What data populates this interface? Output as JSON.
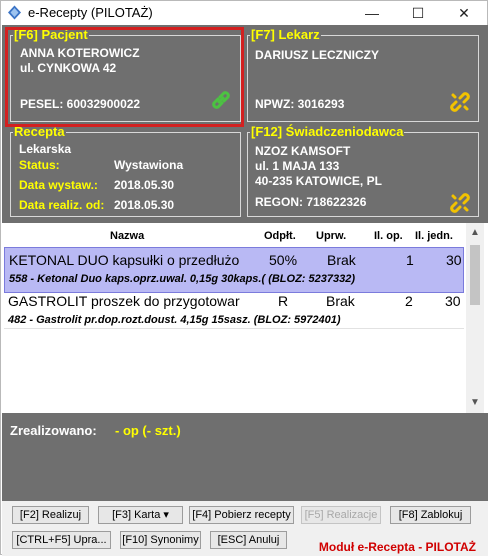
{
  "window": {
    "title": "e-Recepty (PILOTAŻ)",
    "controls": {
      "minimize": "—",
      "maximize": "☐",
      "close": "✕"
    }
  },
  "patient": {
    "legend": "[F6] Pacjent",
    "name": "ANNA KOTEROWICZ",
    "address": "ul. CYNKOWA 42",
    "pesel": "PESEL: 60032900022",
    "link_icon_color": "#4cc242"
  },
  "doctor": {
    "legend": "[F7] Lekarz",
    "name": "DARIUSZ LECZNICZY",
    "npwz": "NPWZ: 3016293",
    "link_icon_color": "#f2c200"
  },
  "prescription": {
    "legend": "Recepta",
    "type": "Lekarska",
    "status_label": "Status:",
    "status_value": "Wystawiona",
    "issue_date_label": "Data wystaw.:",
    "issue_date_value": "2018.05.30",
    "realiz_date_label": "Data realiz. od:",
    "realiz_date_value": "2018.05.30"
  },
  "provider": {
    "legend": "[F12] Świadczeniodawca",
    "name": "NZOZ KAMSOFT",
    "street": "ul. 1 MAJA 133",
    "city": "40-235 KATOWICE, PL",
    "regon": "REGON: 718622326",
    "link_icon_color": "#f2c200"
  },
  "table": {
    "columns": [
      "Nazwa",
      "Odpłt.",
      "Uprw.",
      "Il. op.",
      "Il. jedn."
    ],
    "rows": [
      {
        "name": "KETONAL DUO kapsułki o przedłużo",
        "odplt": "50%",
        "uprw": "Brak",
        "il_op": "1",
        "il_jedn": "30",
        "detail": "558 - Ketonal Duo kaps.oprz.uwal. 0,15g 30kaps.( (BLOZ: 5237332)",
        "selected": true
      },
      {
        "name": "GASTROLIT proszek do przygotowar",
        "odplt": "R",
        "uprw": "Brak",
        "il_op": "2",
        "il_jedn": "30",
        "detail": "482 - Gastrolit pr.dop.rozt.doust. 4,15g 15sasz. (BLOZ: 5972401)",
        "selected": false
      }
    ]
  },
  "summary": {
    "label": "Zrealizowano:",
    "value": "- op (- szt.)"
  },
  "buttons": {
    "realizuj": "[F2] Realizuj",
    "karta": "[F3] Karta ▾",
    "pobierz": "[F4] Pobierz recepty",
    "realizacje": "[F5] Realizacje",
    "zablokuj": "[F8] Zablokuj",
    "upra": "[CTRL+F5] Upra...",
    "synonimy": "[F10] Synonimy",
    "anuluj": "[ESC] Anuluj"
  },
  "module_label": "Moduł e-Recepta - PILOTAŻ",
  "colors": {
    "panel_bg": "#6f6f6f",
    "legend": "#ffff00",
    "highlight": "#d32020",
    "selected_row": "#b9b9f4",
    "module_label": "#d00000"
  }
}
